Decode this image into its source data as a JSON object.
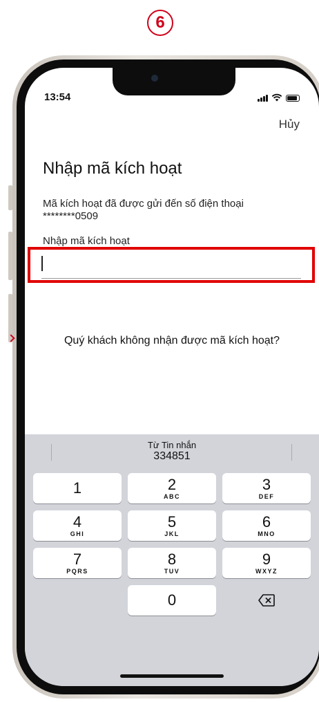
{
  "step_badge": "6",
  "status_bar": {
    "time": "13:54"
  },
  "header": {
    "cancel_label": "Hủy"
  },
  "main": {
    "title": "Nhập mã kích hoạt",
    "description_line1": "Mã kích hoạt đã được gửi đến số điện thoại",
    "description_line2": "********0509",
    "field_label": "Nhập mã kích hoạt",
    "field_value": "",
    "resend_link": "Quý khách không nhận được mã kích hoạt?"
  },
  "keyboard": {
    "suggestion_from": "Từ Tin nhắn",
    "suggestion_code": "334851",
    "keys": [
      {
        "num": "1",
        "letters": ""
      },
      {
        "num": "2",
        "letters": "ABC"
      },
      {
        "num": "3",
        "letters": "DEF"
      },
      {
        "num": "4",
        "letters": "GHI"
      },
      {
        "num": "5",
        "letters": "JKL"
      },
      {
        "num": "6",
        "letters": "MNO"
      },
      {
        "num": "7",
        "letters": "PQRS"
      },
      {
        "num": "8",
        "letters": "TUV"
      },
      {
        "num": "9",
        "letters": "WXYZ"
      },
      {
        "num": "0",
        "letters": ""
      }
    ]
  },
  "icons": {
    "signal": "signal-icon",
    "wifi": "wifi-icon",
    "battery": "battery-icon",
    "delete": "backspace-icon"
  },
  "colors": {
    "highlight": "#e00000",
    "badge": "#d0021b",
    "keyboard_bg": "#d2d4da"
  }
}
